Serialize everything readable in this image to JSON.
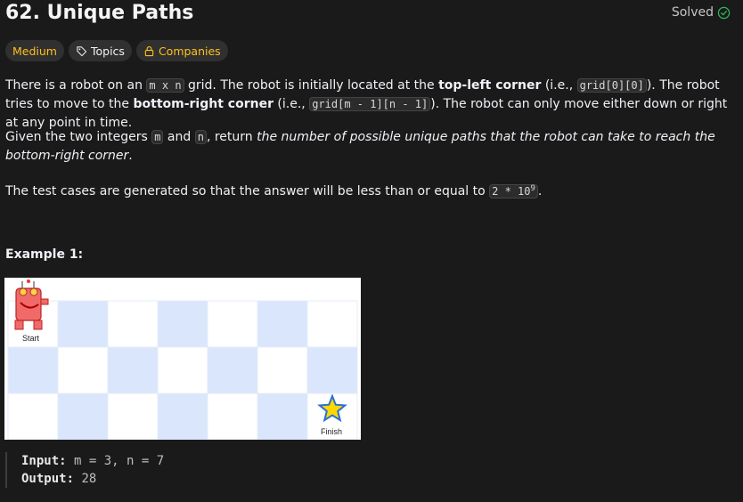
{
  "header": {
    "title": "62. Unique Paths",
    "status": "Solved"
  },
  "badges": {
    "difficulty": "Medium",
    "topics": "Topics",
    "companies": "Companies"
  },
  "description": {
    "p1_a": "There is a robot on an ",
    "p1_code1": "m x n",
    "p1_b": " grid. The robot is initially located at the ",
    "p1_bold1": "top-left corner",
    "p1_c": " (i.e., ",
    "p1_code2": "grid[0][0]",
    "p1_d": "). The robot tries to move to the ",
    "p1_bold2": "bottom-right corner",
    "p1_e": " (i.e., ",
    "p1_code3": "grid[m - 1][n - 1]",
    "p1_f": "). The robot can only move either down or right at any point in time.",
    "p2_a": "Given the two integers ",
    "p2_code1": "m",
    "p2_b": " and ",
    "p2_code2": "n",
    "p2_c": ", return ",
    "p2_italic": "the number of possible unique paths that the robot can take to reach the bottom-right corner",
    "p2_d": ".",
    "p3_a": "The test cases are generated so that the answer will be less than or equal to ",
    "p3_code": "2 * 10",
    "p3_sup": "9",
    "p3_b": "."
  },
  "example": {
    "title": "Example 1:",
    "image_start": "Start",
    "image_finish": "Finish",
    "input_label": "Input:",
    "input_value": "m = 3, n = 7",
    "output_label": "Output:",
    "output_value": "28"
  },
  "colors": {
    "background": "#1a1a1a",
    "difficulty_medium": "#ffc01e",
    "solved_check": "#2cbb5d",
    "grid_blue": "#dae6fc",
    "star_yellow": "#ffd700"
  }
}
